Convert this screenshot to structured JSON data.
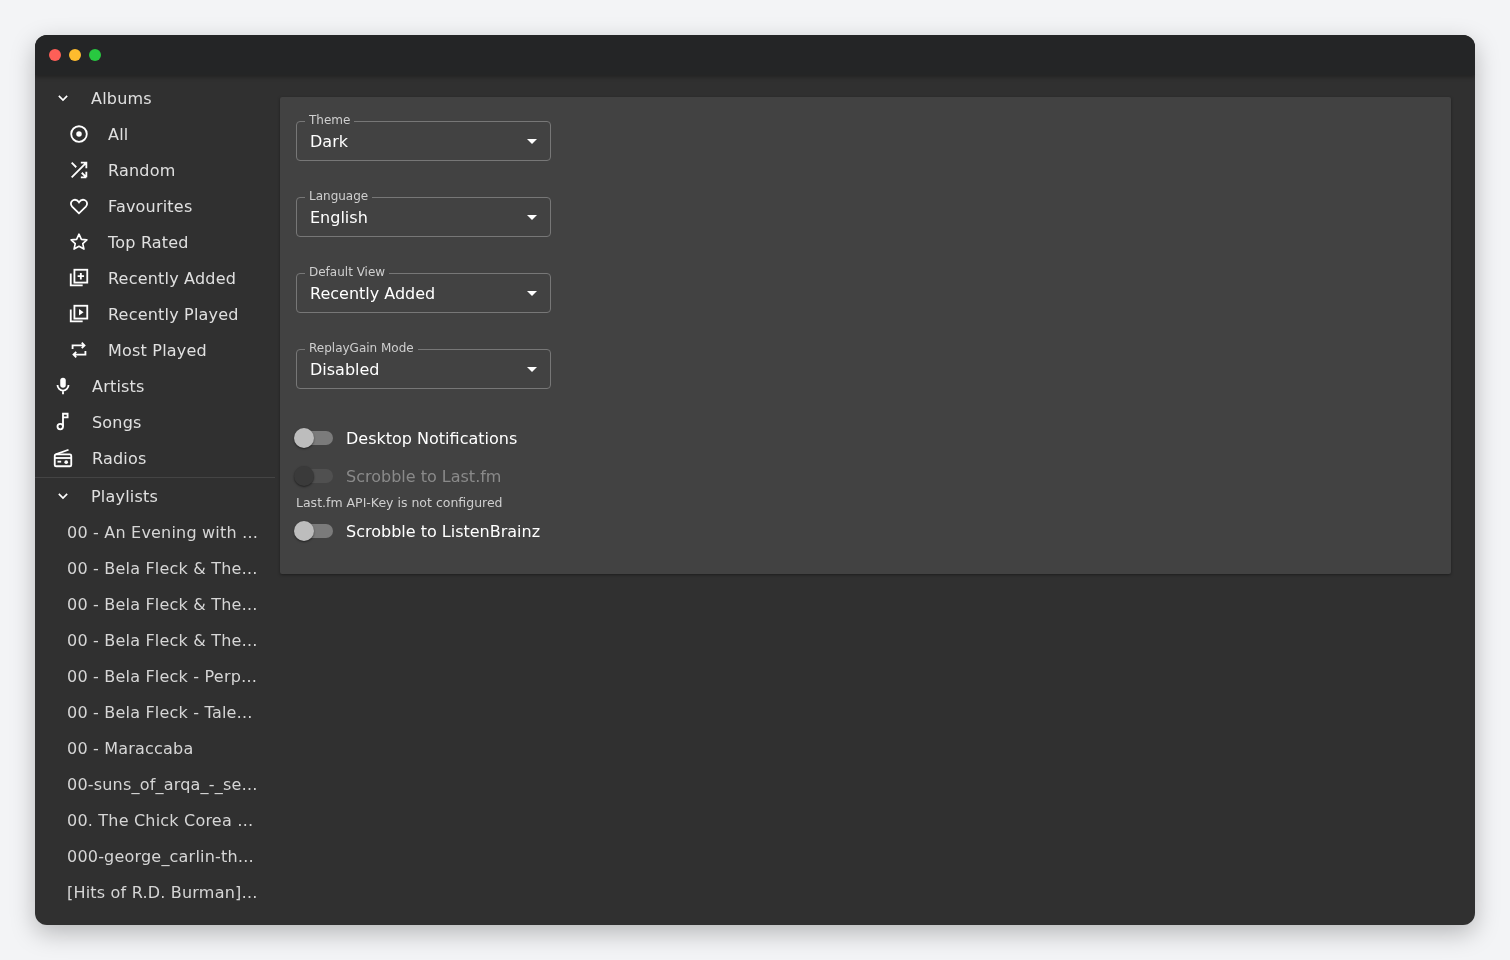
{
  "sidebar": {
    "albums": {
      "label": "Albums",
      "expanded": true,
      "items": [
        {
          "label": "All",
          "kind": "disc"
        },
        {
          "label": "Random",
          "kind": "shuffle"
        },
        {
          "label": "Favourites",
          "kind": "heart"
        },
        {
          "label": "Top Rated",
          "kind": "star"
        },
        {
          "label": "Recently Added",
          "kind": "added"
        },
        {
          "label": "Recently Played",
          "kind": "played"
        },
        {
          "label": "Most Played",
          "kind": "repeat"
        }
      ]
    },
    "links": [
      {
        "label": "Artists",
        "kind": "artists"
      },
      {
        "label": "Songs",
        "kind": "songs"
      },
      {
        "label": "Radios",
        "kind": "radios"
      }
    ],
    "playlists": {
      "label": "Playlists",
      "expanded": true,
      "items": [
        "00 - An Evening with …",
        "00 - Bela Fleck & The…",
        "00 - Bela Fleck & The…",
        "00 - Bela Fleck & The…",
        "00 - Bela Fleck - Perp…",
        "00 - Bela Fleck - Tale…",
        "00 - Maraccaba",
        "00-suns_of_arqa_-_se…",
        "00. The Chick Corea …",
        "000-george_carlin-th…",
        "[Hits of R.D. Burman]…"
      ]
    }
  },
  "settings": {
    "selects": [
      {
        "label": "Theme",
        "value": "Dark"
      },
      {
        "label": "Language",
        "value": "English"
      },
      {
        "label": "Default View",
        "value": "Recently Added"
      },
      {
        "label": "ReplayGain Mode",
        "value": "Disabled"
      }
    ],
    "toggles": [
      {
        "label": "Desktop Notifications",
        "on": false,
        "disabled": false
      },
      {
        "label": "Scrobble to Last.fm",
        "on": false,
        "disabled": true,
        "helper": "Last.fm API-Key is not configured"
      },
      {
        "label": "Scrobble to ListenBrainz",
        "on": false,
        "disabled": false
      }
    ]
  }
}
